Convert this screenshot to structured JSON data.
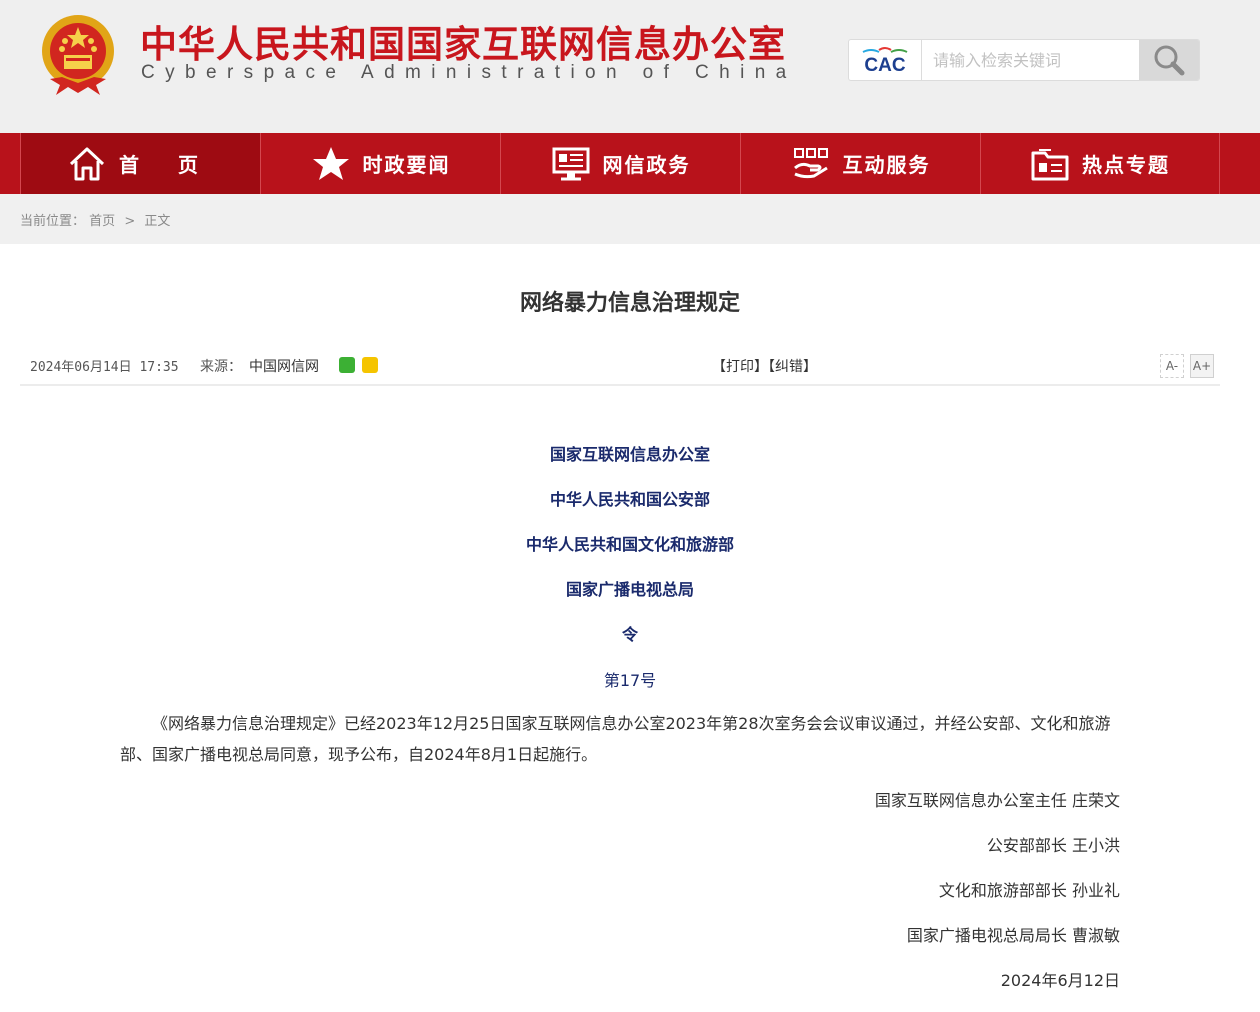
{
  "header": {
    "title_cn": "中华人民共和国国家互联网信息办公室",
    "title_en": "Cyberspace Administration of China",
    "search": {
      "logo_text": "CAC",
      "placeholder": "请输入检索关键词"
    }
  },
  "nav": {
    "items": [
      {
        "label": "首 页",
        "icon": "home-icon",
        "active": true
      },
      {
        "label": "时政要闻",
        "icon": "star-icon",
        "active": false
      },
      {
        "label": "网信政务",
        "icon": "monitor-icon",
        "active": false
      },
      {
        "label": "互动服务",
        "icon": "handshake-icon",
        "active": false
      },
      {
        "label": "热点专题",
        "icon": "folder-icon",
        "active": false
      }
    ]
  },
  "breadcrumb": {
    "prefix": "当前位置：",
    "home": "首页",
    "separator": ">",
    "current": "正文"
  },
  "article": {
    "title": "网络暴力信息治理规定",
    "date": "2024年06月14日 17:35",
    "source_label": "来源：",
    "source": "中国网信网",
    "tools": {
      "print": "【打印】",
      "correct": "【纠错】"
    },
    "font_smaller": "A-",
    "font_larger": "A+",
    "issuers": [
      "国家互联网信息办公室",
      "中华人民共和国公安部",
      "中华人民共和国文化和旅游部",
      "国家广播电视总局",
      "令"
    ],
    "order_no": "第17号",
    "body": "《网络暴力信息治理规定》已经2023年12月25日国家互联网信息办公室2023年第28次室务会会议审议通过，并经公安部、文化和旅游部、国家广播电视总局同意，现予公布，自2024年8月1日起施行。",
    "signatures": [
      "国家互联网信息办公室主任 庄荣文",
      "公安部部长 王小洪",
      "文化和旅游部部长 孙业礼",
      "国家广播电视总局局长 曹淑敏",
      "2024年6月12日"
    ]
  },
  "colors": {
    "brand_red": "#b8121b",
    "title_red": "#c8161d",
    "issuer_blue": "#1a2a6c"
  }
}
